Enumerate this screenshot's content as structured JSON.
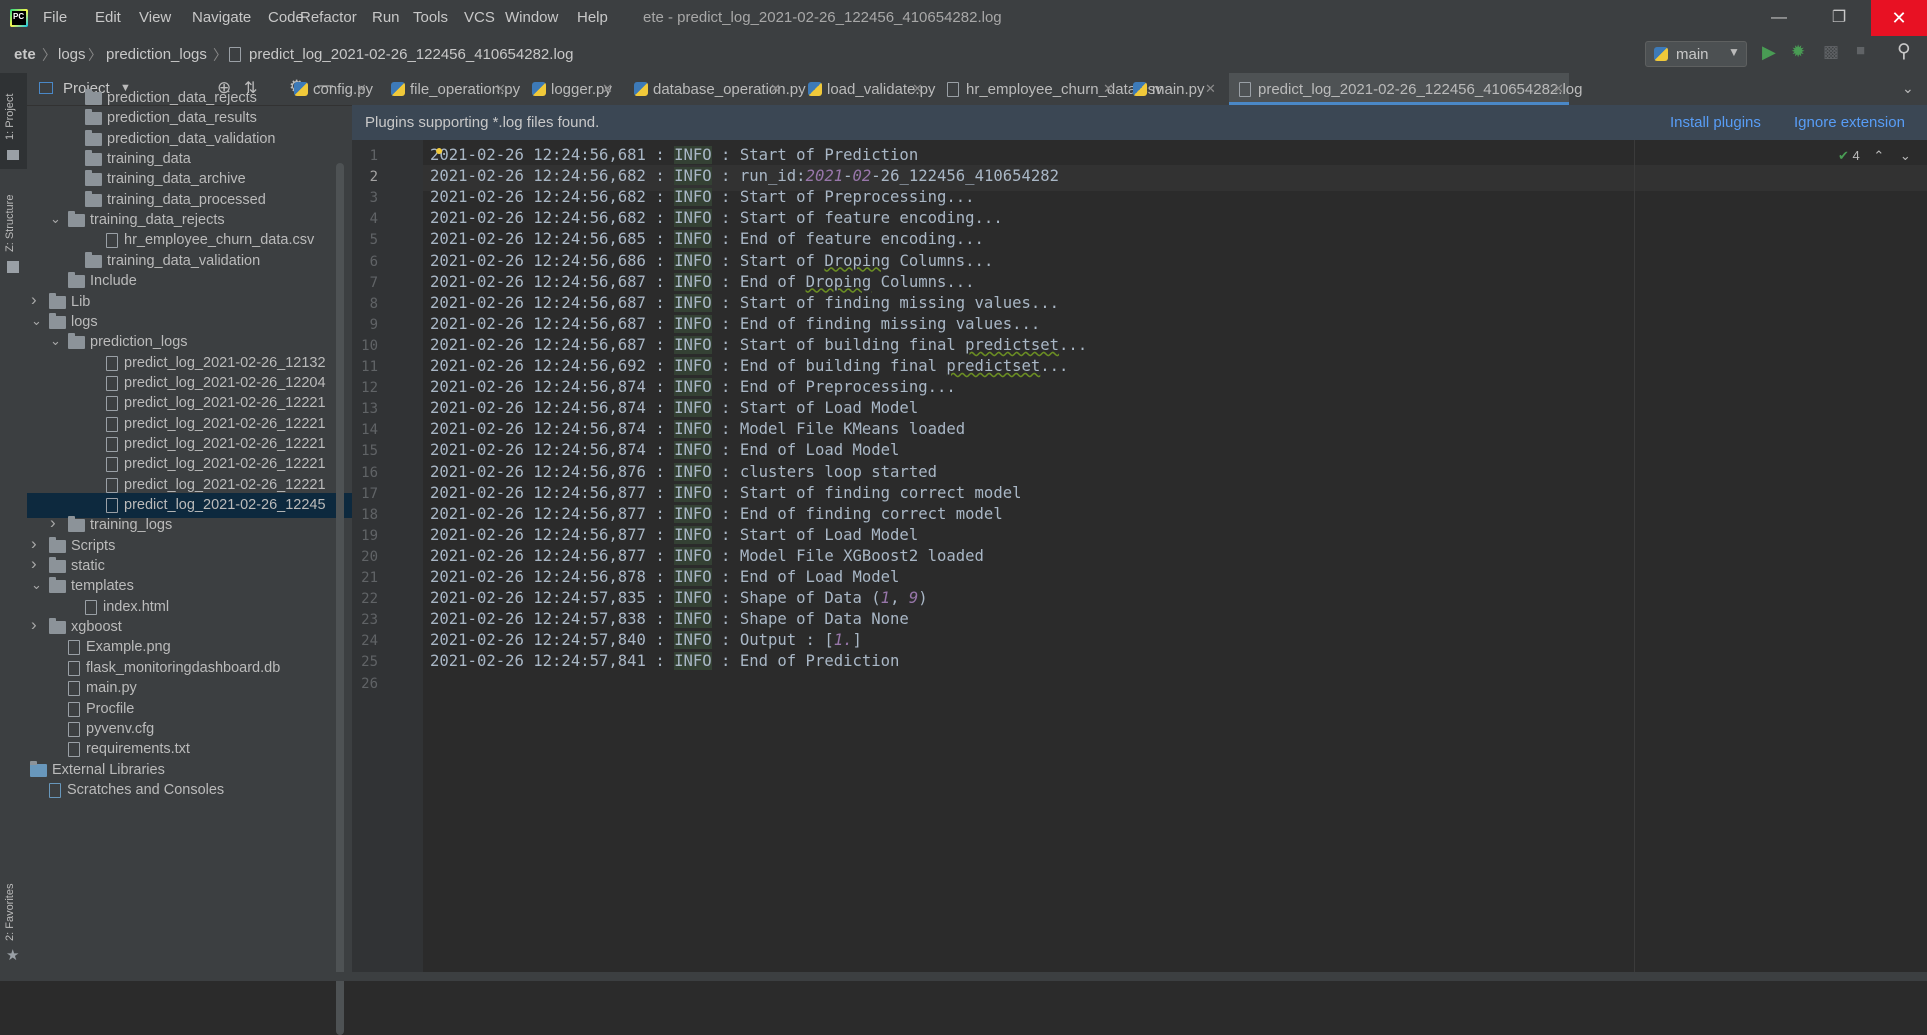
{
  "window": {
    "title": "ete - predict_log_2021-02-26_122456_410654282.log",
    "menu": [
      "File",
      "Edit",
      "View",
      "Navigate",
      "Code",
      "Refactor",
      "Run",
      "Tools",
      "VCS",
      "Window",
      "Help"
    ]
  },
  "breadcrumb": [
    "ete",
    "logs",
    "prediction_logs",
    "predict_log_2021-02-26_122456_410654282.log"
  ],
  "run_config": "main",
  "left_strip": {
    "project": "1: Project",
    "structure": "Z: Structure",
    "favorites": "2: Favorites"
  },
  "project_panel": {
    "title": "Project",
    "tree": [
      {
        "label": "prediction_data_rejects",
        "type": "folder"
      },
      {
        "label": "prediction_data_results",
        "type": "folder"
      },
      {
        "label": "prediction_data_validation",
        "type": "folder"
      },
      {
        "label": "training_data",
        "type": "folder"
      },
      {
        "label": "training_data_archive",
        "type": "folder"
      },
      {
        "label": "training_data_processed",
        "type": "folder"
      },
      {
        "label": "training_data_rejects",
        "type": "folder",
        "state": "expanded"
      },
      {
        "label": "hr_employee_churn_data.csv",
        "type": "file"
      },
      {
        "label": "training_data_validation",
        "type": "folder"
      },
      {
        "label": "Include",
        "type": "folder"
      },
      {
        "label": "Lib",
        "type": "folder",
        "state": "collapsed"
      },
      {
        "label": "logs",
        "type": "folder",
        "state": "expanded"
      },
      {
        "label": "prediction_logs",
        "type": "folder",
        "state": "expanded"
      },
      {
        "label": "predict_log_2021-02-26_12132",
        "type": "file"
      },
      {
        "label": "predict_log_2021-02-26_12204",
        "type": "file"
      },
      {
        "label": "predict_log_2021-02-26_12221",
        "type": "file"
      },
      {
        "label": "predict_log_2021-02-26_12221",
        "type": "file"
      },
      {
        "label": "predict_log_2021-02-26_12221",
        "type": "file"
      },
      {
        "label": "predict_log_2021-02-26_12221",
        "type": "file"
      },
      {
        "label": "predict_log_2021-02-26_12221",
        "type": "file"
      },
      {
        "label": "predict_log_2021-02-26_12245",
        "type": "file",
        "selected": true
      },
      {
        "label": "training_logs",
        "type": "folder",
        "state": "collapsed"
      },
      {
        "label": "Scripts",
        "type": "folder",
        "state": "collapsed"
      },
      {
        "label": "static",
        "type": "folder",
        "state": "collapsed"
      },
      {
        "label": "templates",
        "type": "folder",
        "state": "expanded"
      },
      {
        "label": "index.html",
        "type": "file"
      },
      {
        "label": "xgboost",
        "type": "folder",
        "state": "collapsed"
      },
      {
        "label": "Example.png",
        "type": "file"
      },
      {
        "label": "flask_monitoringdashboard.db",
        "type": "file"
      },
      {
        "label": "main.py",
        "type": "file"
      },
      {
        "label": "Procfile",
        "type": "file"
      },
      {
        "label": "pyvenv.cfg",
        "type": "file"
      },
      {
        "label": "requirements.txt",
        "type": "file"
      },
      {
        "label": "External Libraries",
        "type": "lib",
        "state": "collapsed"
      },
      {
        "label": "Scratches and Consoles",
        "type": "scratch"
      }
    ]
  },
  "tabs": [
    {
      "label": "config.py"
    },
    {
      "label": "file_operation.py"
    },
    {
      "label": "logger.py"
    },
    {
      "label": "database_operation.py"
    },
    {
      "label": "load_validate.py"
    },
    {
      "label": "hr_employee_churn_data.csv"
    },
    {
      "label": "main.py"
    },
    {
      "label": "predict_log_2021-02-26_122456_410654282.log",
      "active": true
    }
  ],
  "banner": {
    "text": "Plugins supporting *.log files found.",
    "install": "Install plugins",
    "ignore": "Ignore extension"
  },
  "inspection_count": "4",
  "editor": {
    "current_line": 2,
    "lines": [
      {
        "ts": "2021-02-26 12:24:56,681",
        "msg": "Start of Prediction"
      },
      {
        "ts": "2021-02-26 12:24:56,682",
        "msg": "run_id:2021-02-26_122456_410654282"
      },
      {
        "ts": "2021-02-26 12:24:56,682",
        "msg": "Start of Preprocessing..."
      },
      {
        "ts": "2021-02-26 12:24:56,682",
        "msg": "Start of feature encoding..."
      },
      {
        "ts": "2021-02-26 12:24:56,685",
        "msg": "End of feature encoding..."
      },
      {
        "ts": "2021-02-26 12:24:56,686",
        "msg": "Start of Droping Columns..."
      },
      {
        "ts": "2021-02-26 12:24:56,687",
        "msg": "End of Droping Columns..."
      },
      {
        "ts": "2021-02-26 12:24:56,687",
        "msg": "Start of finding missing values..."
      },
      {
        "ts": "2021-02-26 12:24:56,687",
        "msg": "End of finding missing values..."
      },
      {
        "ts": "2021-02-26 12:24:56,687",
        "msg": "Start of building final predictset..."
      },
      {
        "ts": "2021-02-26 12:24:56,692",
        "msg": "End of building final predictset..."
      },
      {
        "ts": "2021-02-26 12:24:56,874",
        "msg": "End of Preprocessing..."
      },
      {
        "ts": "2021-02-26 12:24:56,874",
        "msg": "Start of Load Model"
      },
      {
        "ts": "2021-02-26 12:24:56,874",
        "msg": "Model File KMeans loaded"
      },
      {
        "ts": "2021-02-26 12:24:56,874",
        "msg": "End of Load Model"
      },
      {
        "ts": "2021-02-26 12:24:56,876",
        "msg": "clusters loop started"
      },
      {
        "ts": "2021-02-26 12:24:56,877",
        "msg": "Start of finding correct model"
      },
      {
        "ts": "2021-02-26 12:24:56,877",
        "msg": "End of finding correct model"
      },
      {
        "ts": "2021-02-26 12:24:56,877",
        "msg": "Start of Load Model"
      },
      {
        "ts": "2021-02-26 12:24:56,877",
        "msg": "Model File XGBoost2 loaded"
      },
      {
        "ts": "2021-02-26 12:24:56,878",
        "msg": "End of Load Model"
      },
      {
        "ts": "2021-02-26 12:24:57,835",
        "msg": "Shape of Data (1, 9)"
      },
      {
        "ts": "2021-02-26 12:24:57,838",
        "msg": "Shape of Data None"
      },
      {
        "ts": "2021-02-26 12:24:57,840",
        "msg": "Output : [1.]"
      },
      {
        "ts": "2021-02-26 12:24:57,841",
        "msg": "End of Prediction"
      },
      {
        "ts": "",
        "msg": ""
      }
    ],
    "level": "INFO",
    "sep": " : "
  }
}
